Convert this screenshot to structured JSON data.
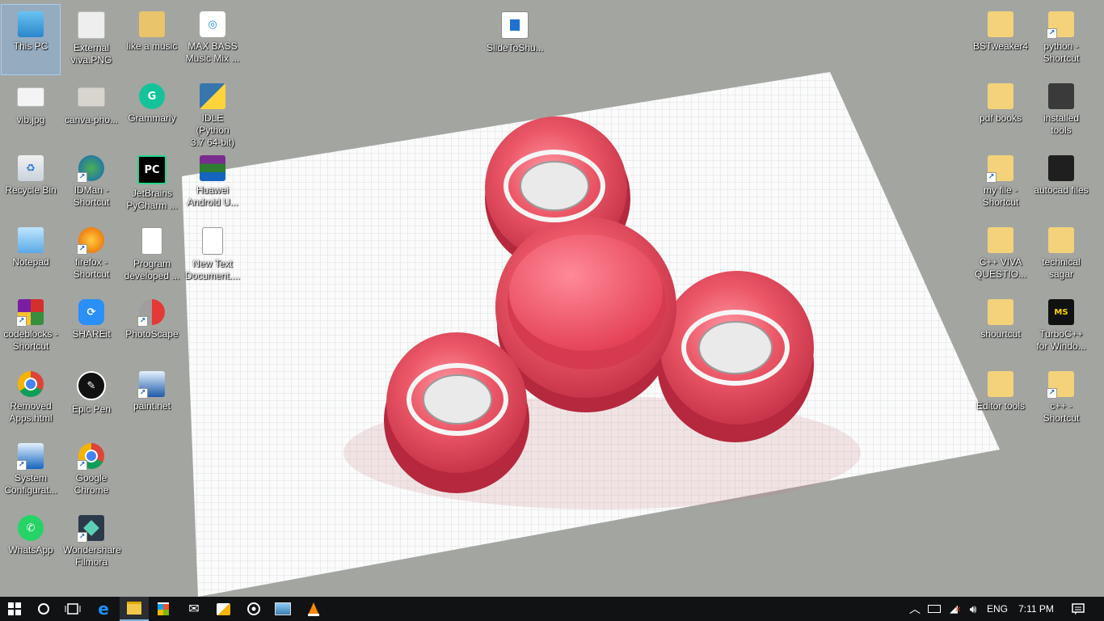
{
  "desktop": {
    "icons": [
      {
        "label": "This PC",
        "icon": "this-pc-icon",
        "selected": true
      },
      {
        "label": "External\nviva.PNG",
        "icon": "image-file-icon"
      },
      {
        "label": "like a music",
        "icon": "folder-icon"
      },
      {
        "label": "MAX BASS\nMusic Mix ...",
        "icon": "media-file-icon"
      },
      {
        "label": "SlideToShu...",
        "icon": "app-icon"
      },
      {
        "label": "BSTweaker4",
        "icon": "folder-icon"
      },
      {
        "label": "python -\nShortcut",
        "icon": "folder-shortcut-icon"
      },
      {
        "label": "vib.jpg",
        "icon": "image-file-icon"
      },
      {
        "label": "canva-pho...",
        "icon": "image-file-icon"
      },
      {
        "label": "Grammarly",
        "icon": "grammarly-icon"
      },
      {
        "label": "IDLE (Python\n3.7 64-bit)",
        "icon": "python-icon"
      },
      {
        "label": "pdf books",
        "icon": "folder-icon"
      },
      {
        "label": "installed\ntools",
        "icon": "folder-icon"
      },
      {
        "label": "Recycle Bin",
        "icon": "recycle-bin-icon"
      },
      {
        "label": "IDMan -\nShortcut",
        "icon": "idm-icon"
      },
      {
        "label": "JetBrains\nPyCharm ...",
        "icon": "pycharm-icon"
      },
      {
        "label": "Huawei\nAndroid U...",
        "icon": "winrar-icon"
      },
      {
        "label": "my file -\nShortcut",
        "icon": "folder-shortcut-icon"
      },
      {
        "label": "autocad files",
        "icon": "folder-icon"
      },
      {
        "label": "Notepad",
        "icon": "notepad-icon"
      },
      {
        "label": "firefox -\nShortcut",
        "icon": "firefox-icon"
      },
      {
        "label": "Program\ndeveloped ...",
        "icon": "text-file-icon"
      },
      {
        "label": "New Text\nDocument....",
        "icon": "text-file-icon"
      },
      {
        "label": "C++ VIVA\nQUESTIO...",
        "icon": "folder-icon"
      },
      {
        "label": "technical\nsagar",
        "icon": "folder-icon"
      },
      {
        "label": "codeblocks -\nShortcut",
        "icon": "codeblocks-icon"
      },
      {
        "label": "SHAREit",
        "icon": "shareit-icon"
      },
      {
        "label": "PhotoScape",
        "icon": "photoscape-icon"
      },
      {
        "label": "shourtcut",
        "icon": "folder-icon"
      },
      {
        "label": "TurboC++\nfor Windo...",
        "icon": "turboc-icon"
      },
      {
        "label": "Removed\nApps.html",
        "icon": "chrome-icon"
      },
      {
        "label": "Epic Pen",
        "icon": "epic-pen-icon"
      },
      {
        "label": "paint.net",
        "icon": "paintnet-icon"
      },
      {
        "label": "Editor tools",
        "icon": "folder-icon"
      },
      {
        "label": "c++ -\nShortcut",
        "icon": "folder-shortcut-icon"
      },
      {
        "label": "System\nConfigurat...",
        "icon": "system-config-icon"
      },
      {
        "label": "Google\nChrome",
        "icon": "chrome-icon"
      },
      {
        "label": "WhatsApp",
        "icon": "whatsapp-icon"
      },
      {
        "label": "Wondershare\nFilmora",
        "icon": "filmora-icon"
      }
    ]
  },
  "taskbar": {
    "pinned": [
      {
        "name": "start-button",
        "icon": "windows-logo-icon"
      },
      {
        "name": "cortana-button",
        "icon": "cortana-circle-icon"
      },
      {
        "name": "task-view-button",
        "icon": "task-view-icon"
      },
      {
        "name": "edge-button",
        "icon": "edge-icon"
      },
      {
        "name": "file-explorer-button",
        "icon": "folder-icon",
        "active": true
      },
      {
        "name": "store-button",
        "icon": "store-icon"
      },
      {
        "name": "mail-button",
        "icon": "mail-icon"
      },
      {
        "name": "paint-button",
        "icon": "paint-icon"
      },
      {
        "name": "groove-button",
        "icon": "groove-icon"
      },
      {
        "name": "photos-button",
        "icon": "photos-icon"
      },
      {
        "name": "vlc-button",
        "icon": "vlc-icon"
      }
    ],
    "tray": {
      "language": "ENG",
      "time": "7:11 PM"
    }
  },
  "colors": {
    "spinner": "#e8505f",
    "taskbar": "#101214",
    "background": "#a3a5a1"
  }
}
